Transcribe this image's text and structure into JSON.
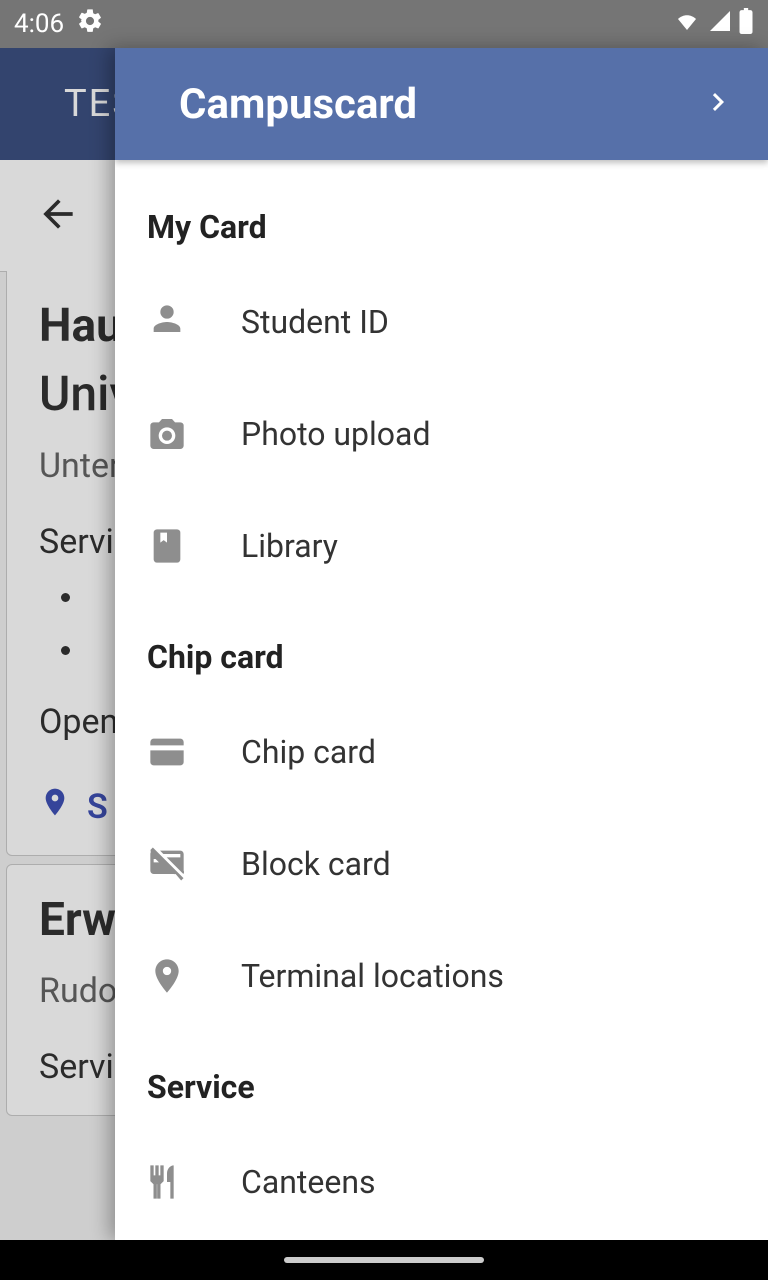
{
  "status": {
    "time": "4:06"
  },
  "bg": {
    "appbar_title": "TES",
    "card1": {
      "title_line1": "Haup",
      "title_line2": "Univ",
      "sub": "Unter",
      "head1": "Servic",
      "head2": "Open",
      "link": "S"
    },
    "card2": {
      "title": "Erwi",
      "sub": "Rudov",
      "head": "Servic"
    }
  },
  "drawer": {
    "title": "Campuscard",
    "sections": [
      {
        "header": "My Card",
        "items": [
          {
            "label": "Student ID"
          },
          {
            "label": "Photo upload"
          },
          {
            "label": "Library"
          }
        ]
      },
      {
        "header": "Chip card",
        "items": [
          {
            "label": "Chip card"
          },
          {
            "label": "Block card"
          },
          {
            "label": "Terminal locations"
          }
        ]
      },
      {
        "header": "Service",
        "items": [
          {
            "label": "Canteens"
          }
        ]
      }
    ]
  }
}
